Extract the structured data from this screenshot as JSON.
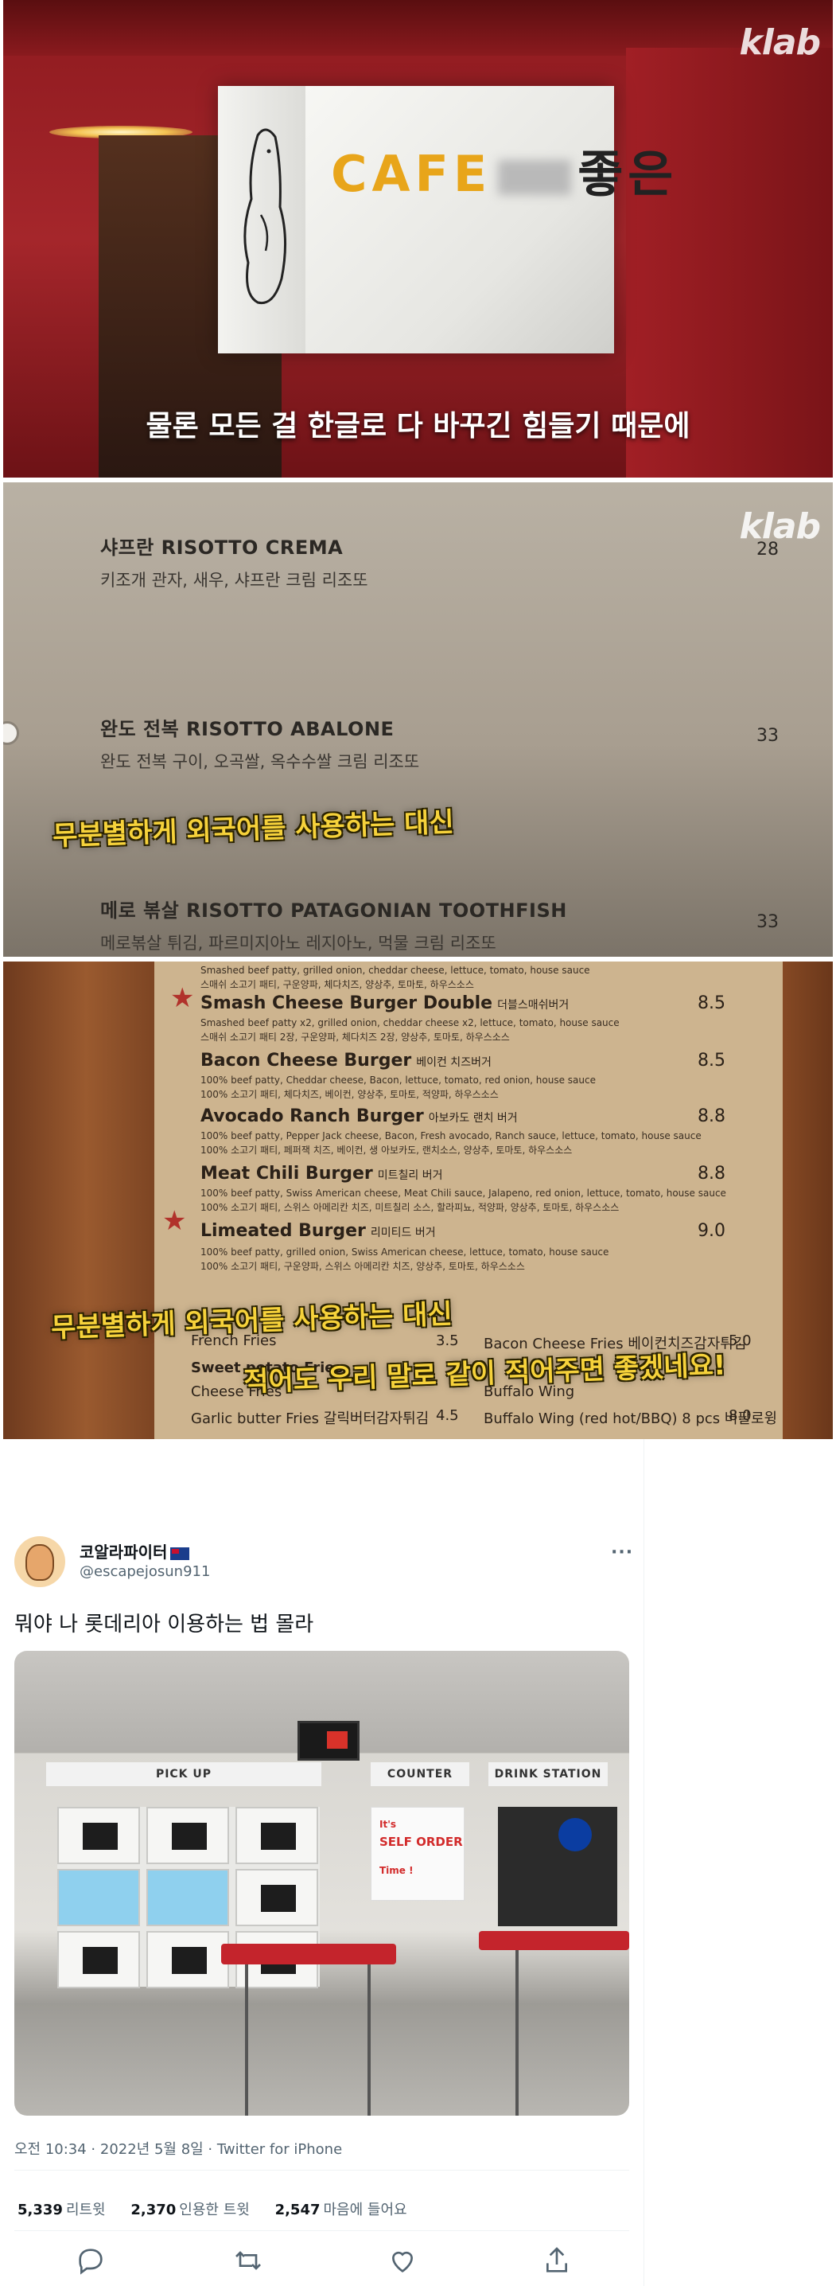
{
  "watermark": "klab",
  "frame1": {
    "sign_cafe": "CAFE",
    "sign_korean": "좋은",
    "subtitle": "물론 모든 걸 한글로 다 바꾸긴 힘들기 때문에"
  },
  "frame2": {
    "items": [
      {
        "name": "샤프란  RISOTTO CREMA",
        "desc": "키조개 관자, 새우, 샤프란 크림 리조또",
        "price": "28"
      },
      {
        "name": "완도 전복  RISOTTO ABALONE",
        "desc": "완도 전복 구이, 오곡쌀, 옥수수쌀 크림 리조또",
        "price": "33"
      },
      {
        "name": "메로 볶살  RISOTTO PATAGONIAN TOOTHFISH",
        "desc": "메로볶살 튀김, 파르미지아노 레지아노, 먹물 크림 리조또",
        "price": "33"
      }
    ],
    "caption": "무분별하게 외국어를 사용하는 대신"
  },
  "frame3": {
    "top_desc": "Smashed beef patty, grilled onion, cheddar cheese, lettuce, tomato, house sauce",
    "top_desc_kor": "스매쉬 소고기 패티, 구운양파, 체다치즈, 양상추, 토마토, 하우스소스",
    "burgers": [
      {
        "name": "Smash Cheese Burger Double",
        "kor": "더블스매쉬버거",
        "price": "8.5",
        "desc": "Smashed beef patty x2, grilled onion, cheddar cheese x2, lettuce, tomato, house sauce",
        "desc_kor": "스매쉬 소고기 패티 2장, 구운양파, 체다치즈 2장, 양상추, 토마토, 하우스소스"
      },
      {
        "name": "Bacon Cheese Burger",
        "kor": "베이컨 치즈버거",
        "price": "8.5",
        "desc": "100% beef patty, Cheddar cheese, Bacon, lettuce, tomato, red onion, house sauce",
        "desc_kor": "100% 소고기 패티, 체다치즈, 베이컨, 양상추, 토마토, 적양파, 하우스소스"
      },
      {
        "name": "Avocado Ranch Burger",
        "kor": "아보카도 랜치 버거",
        "price": "8.8",
        "desc": "100% beef patty, Pepper Jack cheese, Bacon, Fresh avocado, Ranch sauce, lettuce, tomato, house sauce",
        "desc_kor": "100% 소고기 패티, 페퍼잭 치즈, 베이컨, 생 아보카도, 랜치소스, 양상추, 토마토, 하우스소스"
      },
      {
        "name": "Meat Chili Burger",
        "kor": "미트칠리 버거",
        "price": "8.8",
        "desc": "100% beef patty, Swiss American cheese, Meat Chili sauce, Jalapeno, red onion, lettuce, tomato, house sauce",
        "desc_kor": "100% 소고기 패티, 스위스 아메리칸 치즈, 미트칠리 소스, 할라피뇨, 적양파, 양상추, 토마토, 하우스소스"
      },
      {
        "name": "Limeated Burger",
        "kor": "리미티드 버거",
        "price": "9.0",
        "desc": "100% beef patty, grilled onion, Swiss American cheese, lettuce, tomato, house sauce",
        "desc_kor": "100% 소고기 패티, 구운양파, 스위스 아메리칸 치즈, 양상추, 토마토, 하우스소스"
      }
    ],
    "sides_left": [
      {
        "name": "French Fries",
        "price": "3.5"
      },
      {
        "name": "Sweet potato Fries",
        "price": ""
      },
      {
        "name": "Cheese Fries",
        "price": ""
      },
      {
        "name": "Garlic butter Fries  갈릭버터감자튀김",
        "price": "4.5"
      }
    ],
    "sides_right": [
      {
        "name": "Bacon Cheese Fries  베이컨치즈감자튀김",
        "price": "5.0"
      },
      {
        "name": "",
        "price": ""
      },
      {
        "name": "Buffalo Wing",
        "price": ""
      },
      {
        "name": "Buffalo Wing (red hot/BBQ) 8 pcs 버팔로윙",
        "price": "8.0"
      }
    ],
    "caption1": "무분별하게 외국어를 사용하는 대신",
    "caption2": "적어도 우리 말로 같이 적어주면 좋겠네요!"
  },
  "tweet": {
    "display_name": "코알라파이터",
    "handle": "@escapejosun911",
    "more_label": "···",
    "text": "뭐야 나 롯데리아 이용하는 법 몰라",
    "photo_labels": {
      "pickup": "PICK UP",
      "counter": "COUNTER",
      "drink": "DRINK STATION",
      "poster_top": "It's",
      "poster_mid": "SELF ORDER",
      "poster_bot": "Time !",
      "pepsi": "pepsi"
    },
    "meta": "오전 10:34 · 2022년 5월 8일 · Twitter for iPhone",
    "stats": [
      {
        "count": "5,339",
        "label": "리트윗"
      },
      {
        "count": "2,370",
        "label": "인용한 트윗"
      },
      {
        "count": "2,547",
        "label": "마음에 들어요"
      }
    ],
    "actions": [
      "reply-icon",
      "retweet-icon",
      "like-icon",
      "share-icon"
    ],
    "colors": {
      "text": "#0f1419",
      "secondary": "#536471",
      "divider": "#eff3f4"
    }
  }
}
